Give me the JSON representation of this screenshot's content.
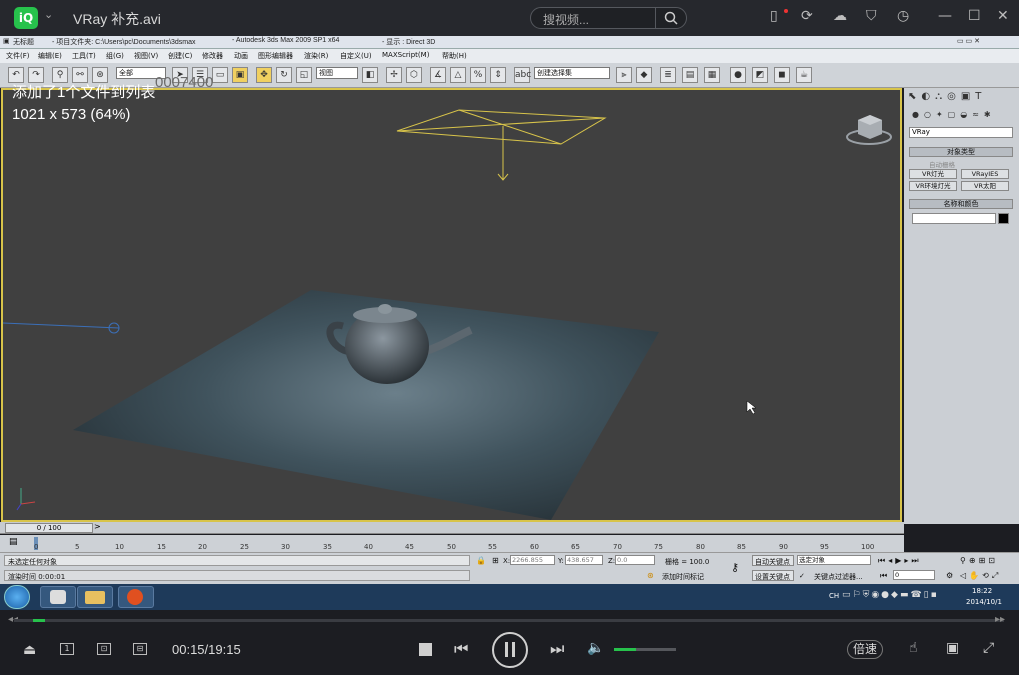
{
  "player": {
    "title": "VRay 补充.avi",
    "search_placeholder": "搜视频...",
    "time": "00:15/19:15",
    "speed_label": "倍速",
    "progress_fraction": 0.012,
    "volume_fraction": 0.35
  },
  "max": {
    "titlebar": {
      "name": "无标题",
      "path": "- 项目文件夹: C:\\Users\\pc\\Documents\\3dsmax",
      "app": "- Autodesk 3ds Max  2009 SP1  x64",
      "display": "- 显示 : Direct 3D"
    },
    "menu": [
      "文件(F)",
      "编辑(E)",
      "工具(T)",
      "组(G)",
      "视图(V)",
      "创建(C)",
      "修改器",
      "动画",
      "图形编辑器",
      "渲染(R)",
      "自定义(U)",
      "MAXScript(M)",
      "帮助(H)"
    ],
    "toolbar": {
      "filter": "全部",
      "refcoord": "视图",
      "selset": "创建选择集"
    },
    "viewport": {
      "overlay1": "添加了1个文件到列表",
      "overlay2": "1021 x 573 (64%)",
      "watermark": "0007400"
    },
    "panel": {
      "renderer": "VRay",
      "rollout1": "对象类型",
      "autogrid": "自动栅格",
      "buttons": [
        "VR灯光",
        "VRayIES",
        "VR环境灯光",
        "VR太阳"
      ],
      "rollout2": "名称和颜色"
    },
    "timeslider": "0 / 100",
    "ticks": [
      "0",
      "5",
      "10",
      "15",
      "20",
      "25",
      "30",
      "35",
      "40",
      "45",
      "50",
      "55",
      "60",
      "65",
      "70",
      "75",
      "80",
      "85",
      "90",
      "95",
      "100"
    ],
    "status": {
      "sel": "未选定任何对象",
      "script": "渲染时间  0:00:01",
      "x": "2266.855",
      "y": "438.657",
      "z": "0.0",
      "grid": "栅格 = 100.0",
      "add_tag": "添加时间标记",
      "autokey": "自动关键点",
      "setkey": "设置关键点",
      "selmode": "选定对象",
      "keyfilter": "关键点过滤器...",
      "frame": "0"
    }
  },
  "taskbar": {
    "time": "18:22",
    "date": "2014/10/1",
    "lang": "CH"
  }
}
